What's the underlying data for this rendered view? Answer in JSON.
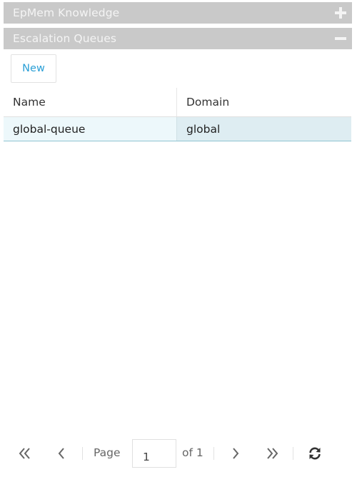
{
  "panels": [
    {
      "title": "EpMem Knowledge",
      "expanded": false
    },
    {
      "title": "Escalation Queues",
      "expanded": true
    }
  ],
  "toolbar": {
    "new_label": "New"
  },
  "grid": {
    "columns": [
      "Name",
      "Domain"
    ],
    "rows": [
      {
        "name": "global-queue",
        "domain": "global"
      }
    ]
  },
  "pager": {
    "page_label": "Page",
    "page_value": "1",
    "of_label": "of 1"
  },
  "colors": {
    "header_bg": "#c9c9c9",
    "accent": "#2a9fd6",
    "selected_row": "#deedf2"
  }
}
